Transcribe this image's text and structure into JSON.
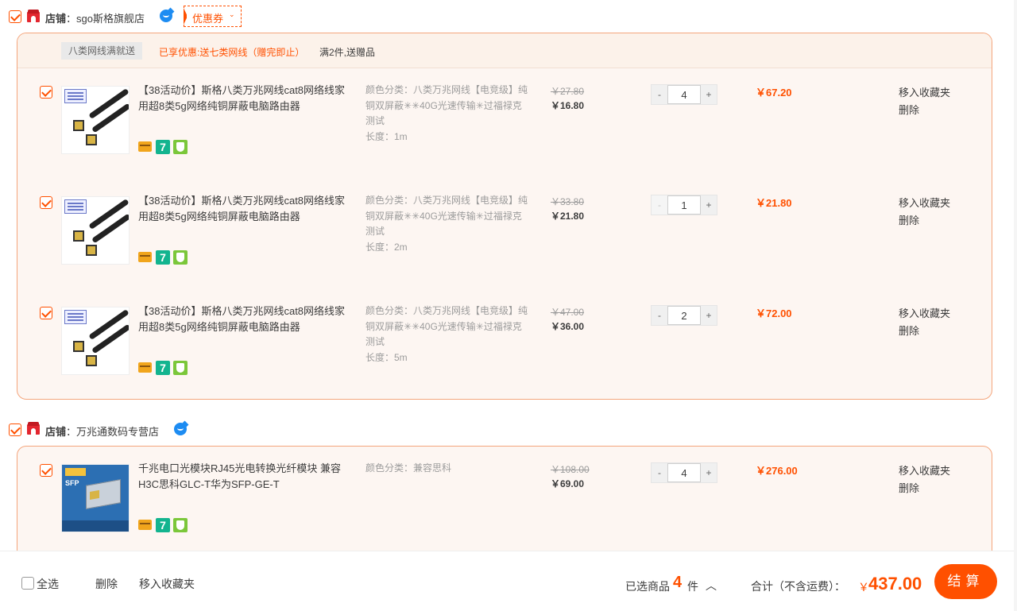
{
  "shops": [
    {
      "label_prefix": "店铺",
      "colon": "：",
      "name": "sgo斯格旗舰店",
      "coupon_label": "优惠券",
      "coupon_chevron": "⌄",
      "promo": {
        "tag": "八类网线满就送",
        "highlight": "已享优惠:送七类网线（赠完即止）",
        "note": "满2件,送赠品"
      },
      "items": [
        {
          "title": "【38活动价】斯格八类万兆网线cat8网络线家用超8类5g网络纯铜屏蔽电脑路由器",
          "spec_color": "颜色分类：八类万兆网线【电竞级】纯铜双屏蔽✳✳40G光速传输✳过福禄克测试",
          "spec_length": "长度：1m",
          "price_old": "￥27.80",
          "price_now": "￥16.80",
          "qty": "4",
          "minus_disabled": false,
          "subtotal": "￥67.20",
          "op_fav": "移入收藏夹",
          "op_del": "删除"
        },
        {
          "title": "【38活动价】斯格八类万兆网线cat8网络线家用超8类5g网络纯铜屏蔽电脑路由器",
          "spec_color": "颜色分类：八类万兆网线【电竞级】纯铜双屏蔽✳✳40G光速传输✳过福禄克测试",
          "spec_length": "长度：2m",
          "price_old": "￥33.80",
          "price_now": "￥21.80",
          "qty": "1",
          "minus_disabled": true,
          "subtotal": "￥21.80",
          "op_fav": "移入收藏夹",
          "op_del": "删除"
        },
        {
          "title": "【38活动价】斯格八类万兆网线cat8网络线家用超8类5g网络纯铜屏蔽电脑路由器",
          "spec_color": "颜色分类：八类万兆网线【电竞级】纯铜双屏蔽✳✳40G光速传输✳过福禄克测试",
          "spec_length": "长度：5m",
          "price_old": "￥47.00",
          "price_now": "￥36.00",
          "qty": "2",
          "minus_disabled": false,
          "subtotal": "￥72.00",
          "op_fav": "移入收藏夹",
          "op_del": "删除"
        }
      ]
    },
    {
      "label_prefix": "店铺",
      "colon": "：",
      "name": "万兆通数码专营店",
      "items": [
        {
          "title": "千兆电口光模块RJ45光电转换光纤模块 兼容H3C思科GLC-T华为SFP-GE-T",
          "spec_color": "颜色分类：兼容思科",
          "spec_length": "",
          "price_old": "￥108.00",
          "price_now": "￥69.00",
          "qty": "4",
          "minus_disabled": false,
          "subtotal": "￥276.00",
          "op_fav": "移入收藏夹",
          "op_del": "删除",
          "thumb_title": "SFP"
        }
      ]
    }
  ],
  "qty_minus": "-",
  "qty_plus": "+",
  "seven_badge": "7",
  "footer": {
    "select_all": "全选",
    "delete": "删除",
    "move_to_fav": "移入收藏夹",
    "selected_label": "已选商品",
    "selected_count": "4",
    "selected_unit": "件",
    "expand_icon": "︿",
    "total_label": "合计（不含运费）：",
    "currency": "￥",
    "total": "437.00",
    "checkout": "结算"
  },
  "colors": {
    "accent": "#ff5000",
    "group_border": "#f4a57c",
    "group_bg": "#fdf6f2"
  }
}
